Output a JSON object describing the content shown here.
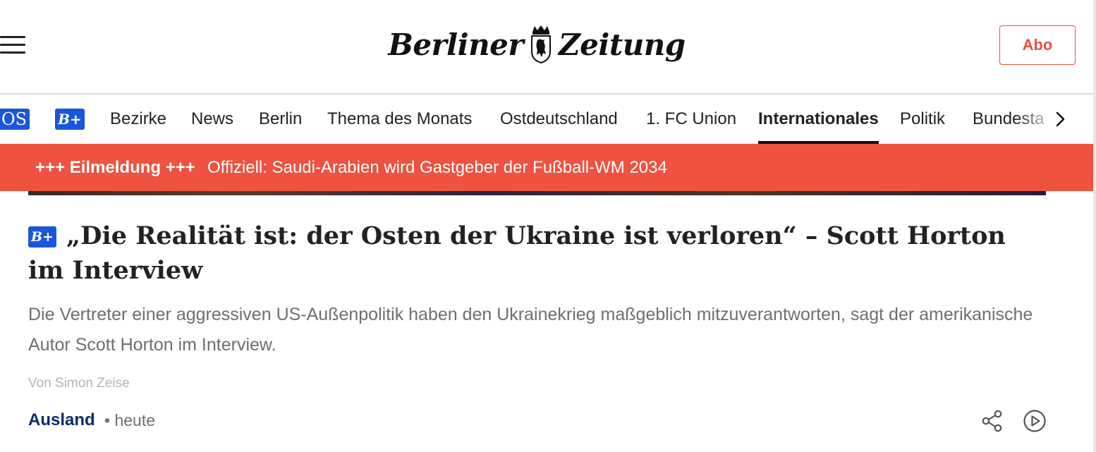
{
  "header": {
    "logo_left": "Berliner",
    "logo_right": "Zeitung",
    "abo_label": "Abo"
  },
  "nav": {
    "os_label": "OS",
    "bplus_label": "B+",
    "items": [
      "Bezirke",
      "News",
      "Berlin",
      "Thema des Monats",
      "Ostdeutschland",
      "1. FC Union",
      "Internationales",
      "Politik",
      "Bundesta"
    ],
    "active": "Internationales"
  },
  "breaking": {
    "label": "+++ Eilmeldung +++",
    "text": "Offiziell: Saudi-Arabien wird Gastgeber der Fußball-WM 2034"
  },
  "article": {
    "badge": "B+",
    "headline": "„Die Realität ist: der Osten der Ukraine ist verloren“ – Scott Horton im Interview",
    "teaser": "Die Vertreter einer aggressiven US-Außenpolitik haben den Ukrainekrieg maßgeblich mitzuverantworten, sagt der amerikanische Autor Scott Horton im Interview.",
    "author": "Von Simon Zeise",
    "category": "Ausland",
    "date": "• heute"
  },
  "colors": {
    "accent_red": "#ee5240",
    "brand_blue": "#1a56db",
    "category_navy": "#0d2a6b"
  },
  "icons": [
    "menu-icon",
    "chevron-right-icon",
    "share-icon",
    "play-icon"
  ]
}
